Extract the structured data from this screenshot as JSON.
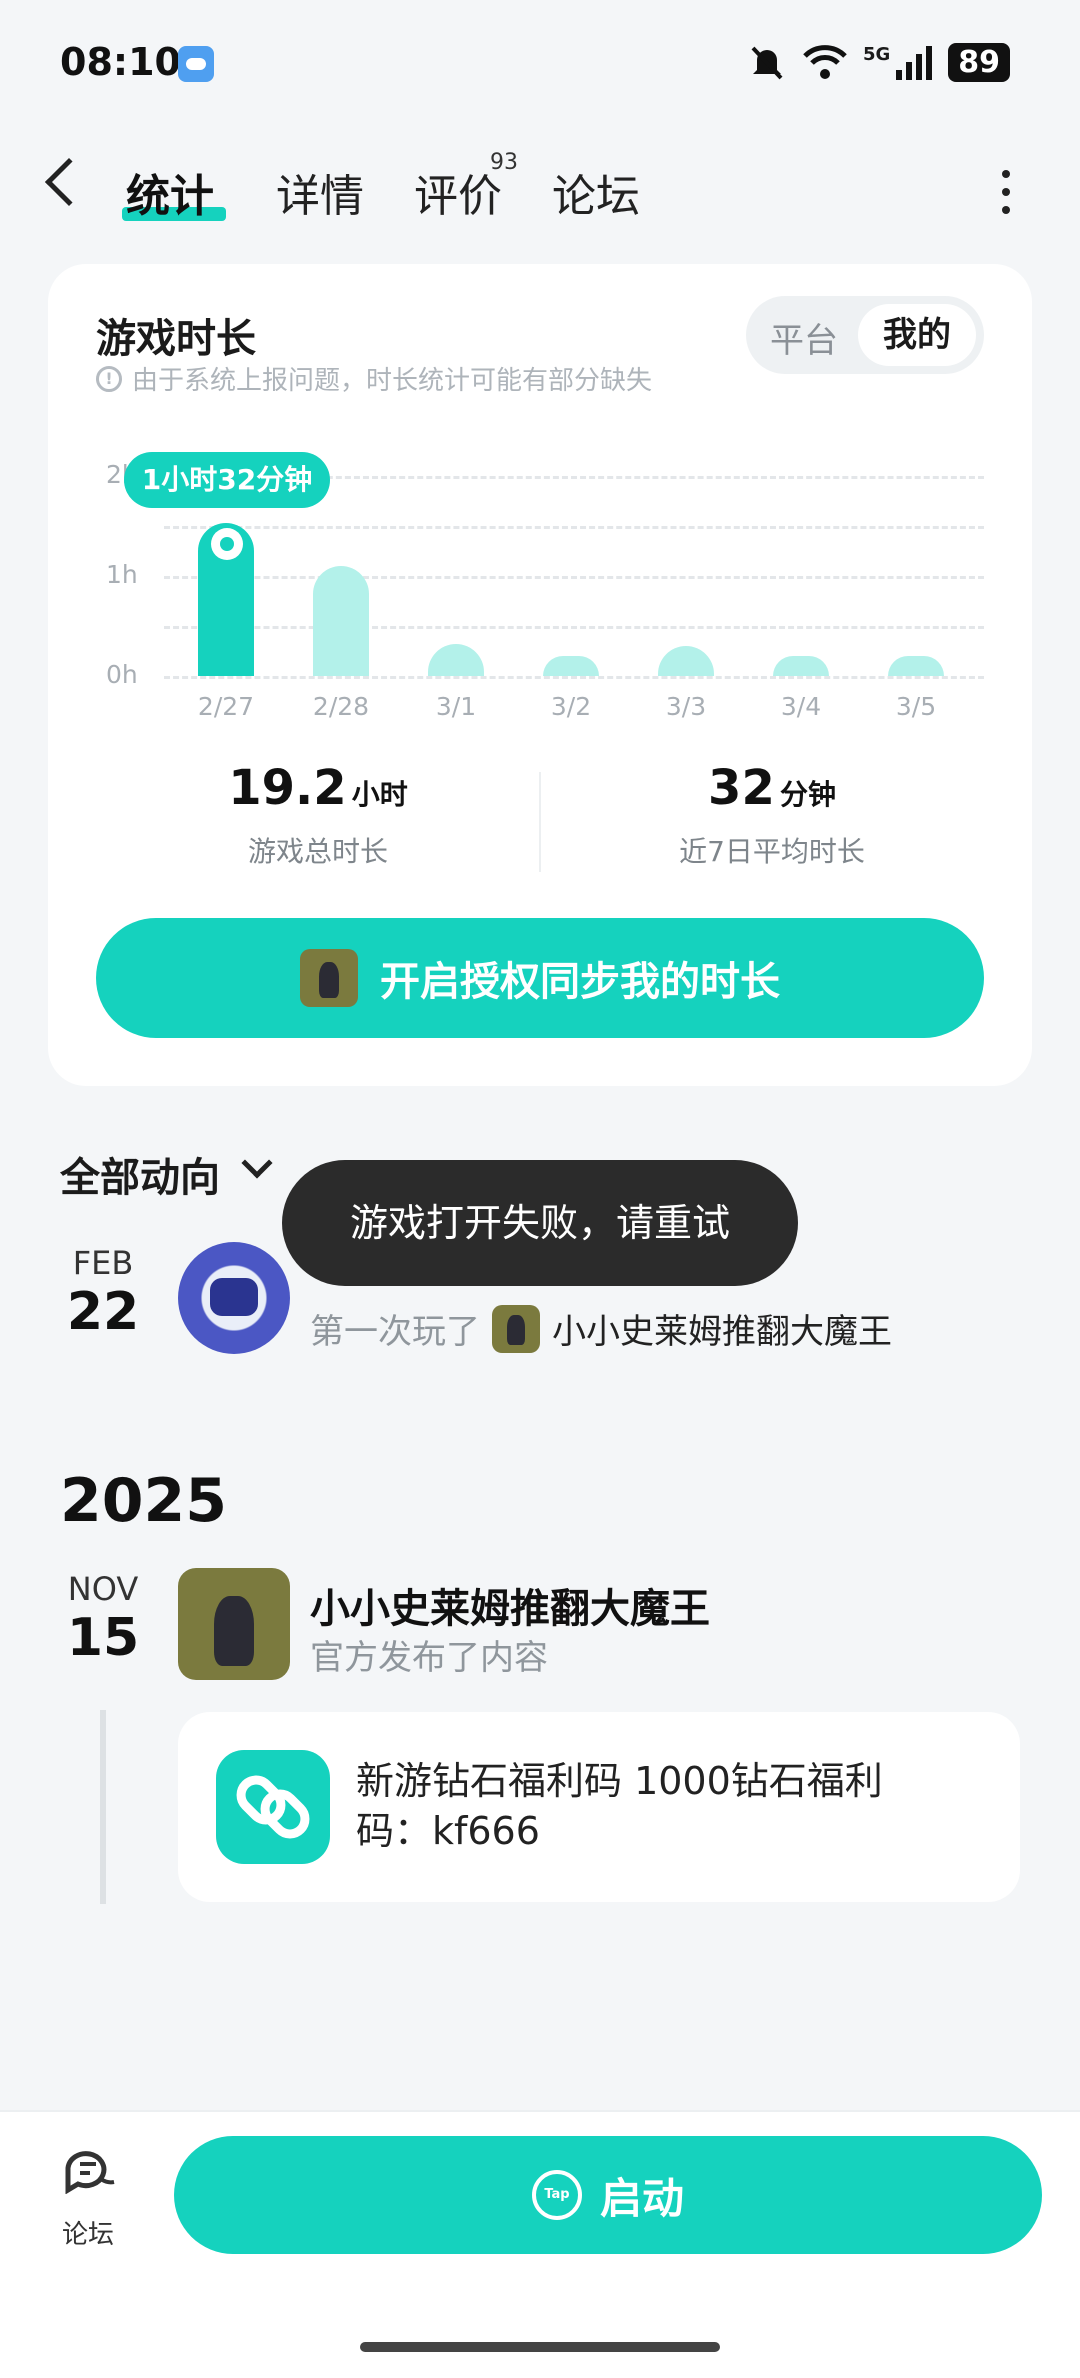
{
  "status": {
    "time": "08:10",
    "network": "5G",
    "battery": "89"
  },
  "nav": {
    "tabs": [
      {
        "label": "统计",
        "active": true
      },
      {
        "label": "详情"
      },
      {
        "label": "评价",
        "badge": "93"
      },
      {
        "label": "论坛"
      }
    ]
  },
  "card": {
    "title": "游戏时长",
    "notice": "由于系统上报问题，时长统计可能有部分缺失",
    "toggle": {
      "platform": "平台",
      "mine": "我的"
    },
    "tooltip": "1小时32分钟",
    "stats": [
      {
        "value": "19.2",
        "unit": "小时",
        "label": "游戏总时长"
      },
      {
        "value": "32",
        "unit": "分钟",
        "label": "近7日平均时长"
      }
    ],
    "sync_button": "开启授权同步我的时长"
  },
  "chart_data": {
    "type": "bar",
    "categories": [
      "2/27",
      "2/28",
      "3/1",
      "3/2",
      "3/3",
      "3/4",
      "3/5"
    ],
    "values": [
      1.53,
      1.1,
      0.32,
      0.2,
      0.3,
      0.14,
      0.18
    ],
    "ylim": [
      0,
      2
    ],
    "yticks": [
      "0h",
      "1h",
      "2h"
    ],
    "highlight_index": 0,
    "colors": {
      "highlight": "#15d2be",
      "normal": "#b3f1ea"
    }
  },
  "feed": {
    "filter_label": "全部动向",
    "toast": "游戏打开失败，请重试",
    "entry1": {
      "month": "FEB",
      "day": "22",
      "action": "第一次玩了",
      "game": "小小史莱姆推翻大魔王"
    },
    "year": "2025",
    "entry2": {
      "month": "NOV",
      "day": "15",
      "game": "小小史莱姆推翻大魔王",
      "action": "官方发布了内容",
      "post": "新游钻石福利码 1000钻石福利码：kf666"
    }
  },
  "bottom": {
    "forum_label": "论坛",
    "launch_label": "启动",
    "launch_icon_text": "Tap"
  },
  "colors": {
    "accent": "#15d2be",
    "accent_light": "#b3f1ea"
  }
}
